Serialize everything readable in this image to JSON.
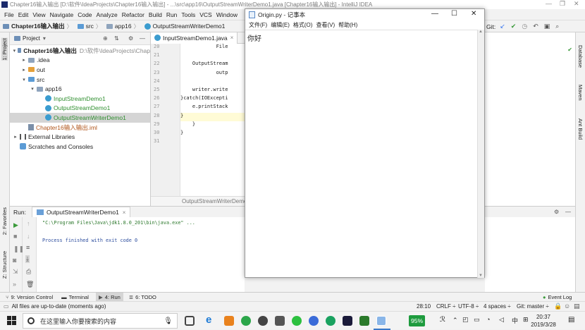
{
  "window": {
    "title": "Chapter16输入输出 [D:\\软件\\IdeaProjects\\Chapter16输入输出] - ...\\src\\app16\\OutputStreamWriterDemo1.java [Chapter16输入输出] - IntelliJ IDEA"
  },
  "menu": [
    "File",
    "Edit",
    "View",
    "Navigate",
    "Code",
    "Analyze",
    "Refactor",
    "Build",
    "Run",
    "Tools",
    "VCS",
    "Window"
  ],
  "breadcrumb": {
    "project": "Chapter16输入输出",
    "src": "src",
    "pkg": "app16",
    "file": "OutputStreamWriterDemo1"
  },
  "git_label": "Git:",
  "left_strip": {
    "project": "1: Project",
    "favorites": "2: Favorites",
    "structure": "Z: Structure"
  },
  "right_strip": {
    "database": "Database",
    "maven": "Maven",
    "ant": "Ant Build"
  },
  "project_panel": {
    "title": "Project",
    "tree": [
      {
        "label": "Chapter16输入输出",
        "extra": "D:\\软件\\IdeaProjects\\Chap",
        "indent": 0,
        "arrow": "▾",
        "kind": "root"
      },
      {
        "label": ".idea",
        "indent": 1,
        "arrow": "▸",
        "kind": "folder"
      },
      {
        "label": "out",
        "indent": 1,
        "arrow": "▸",
        "kind": "folder-orange"
      },
      {
        "label": "src",
        "indent": 1,
        "arrow": "▾",
        "kind": "folder-blue"
      },
      {
        "label": "app16",
        "indent": 2,
        "arrow": "▾",
        "kind": "package"
      },
      {
        "label": "InputStreamDemo1",
        "indent": 3,
        "arrow": "",
        "kind": "class"
      },
      {
        "label": "OutputStreamDemo1",
        "indent": 3,
        "arrow": "",
        "kind": "class"
      },
      {
        "label": "OutputStreamWriterDemo1",
        "indent": 3,
        "arrow": "",
        "kind": "class-selected"
      },
      {
        "label": "Chapter16输入输出.iml",
        "indent": 1,
        "arrow": "",
        "kind": "iml"
      },
      {
        "label": "External Libraries",
        "indent": 0,
        "arrow": "▸",
        "kind": "lib"
      },
      {
        "label": "Scratches and Consoles",
        "indent": 0,
        "arrow": "",
        "kind": "scratch"
      }
    ]
  },
  "editor": {
    "tab_active": "InputStreamDemo1.java",
    "line_numbers": [
      "20",
      "21",
      "22",
      "23",
      "24",
      "25",
      "26",
      "27",
      "28",
      "29",
      "30",
      "31"
    ],
    "code_lines": [
      "            File",
      "",
      "    OutputStream",
      "            outp",
      "",
      "    writer.write",
      "}catch(IOExcepti",
      "    e.printStack",
      "}",
      "    }",
      "}",
      ""
    ],
    "breadcrumb_footer": "OutputStreamWriterDemo1"
  },
  "notepad": {
    "title": "Origin.py - 记事本",
    "menu": [
      "文件(F)",
      "编辑(E)",
      "格式(O)",
      "查看(V)",
      "帮助(H)"
    ],
    "content": "你好"
  },
  "run_panel": {
    "label": "Run:",
    "tab": "OutputStreamWriterDemo1",
    "console_lines": [
      "\"C:\\Program Files\\Java\\jdk1.8.0_201\\bin\\java.exe\" ...",
      "",
      "Process finished with exit code 0"
    ]
  },
  "bottom_tools": [
    {
      "label": "9: Version Control"
    },
    {
      "label": "Terminal"
    },
    {
      "label": "4: Run"
    },
    {
      "label": "6: TODO"
    }
  ],
  "event_log": "Event Log",
  "status": {
    "message": "All files are up-to-date (moments ago)",
    "position": "28:10",
    "line_sep": "CRLF ÷",
    "encoding": "UTF-8 ÷",
    "indent": "4 spaces ÷",
    "git": "Git: master ÷"
  },
  "taskbar": {
    "search_placeholder": "在这里输入你要搜索的内容",
    "battery": "95%",
    "ime": "中",
    "time": "20:37",
    "date": "2019/3/28"
  }
}
